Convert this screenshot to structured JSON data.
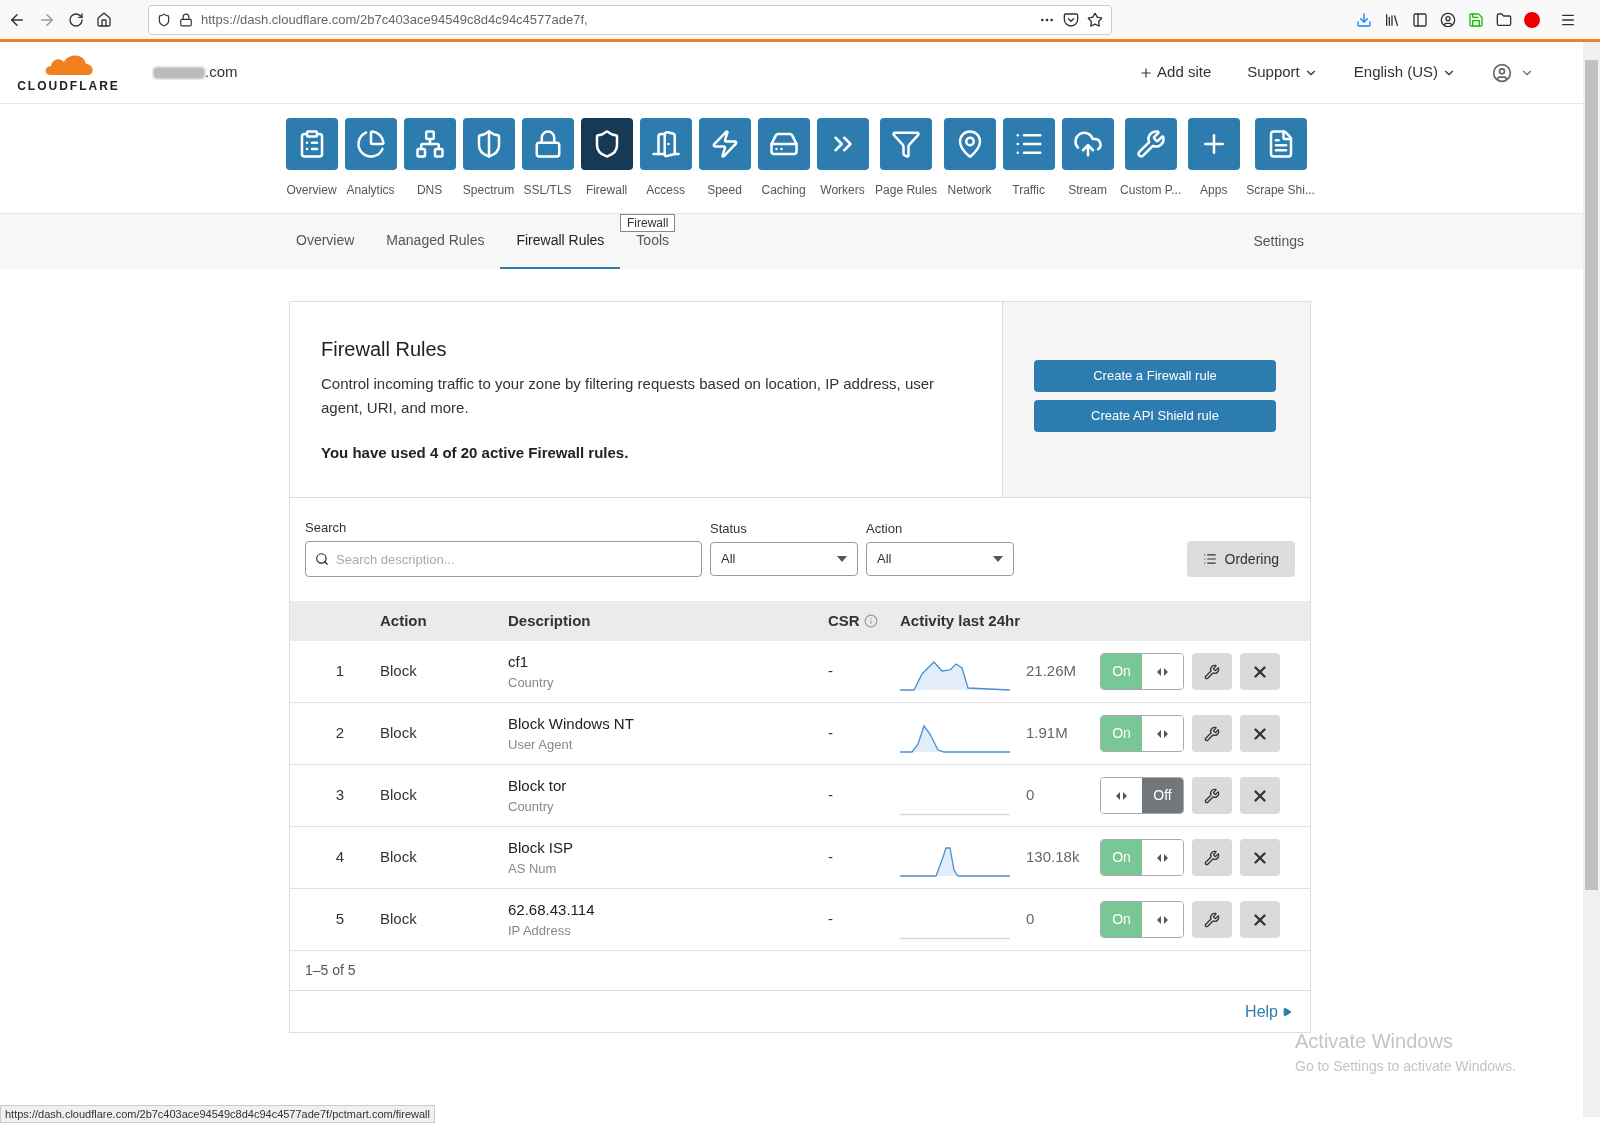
{
  "browser": {
    "url_host": "https://dash.cloudflare.com",
    "url_path": "/2b7c403ace94549c8d4c94c4577ade7f,",
    "status_url": "https://dash.cloudflare.com/2b7c403ace94549c8d4c94c4577ade7f/pctmart.com/firewall"
  },
  "header": {
    "logo": "CLOUDFLARE",
    "domain": ".com",
    "add_site": "Add site",
    "support": "Support",
    "language": "English (US)"
  },
  "apps": [
    {
      "label": "Overview",
      "selected": false
    },
    {
      "label": "Analytics",
      "selected": false
    },
    {
      "label": "DNS",
      "selected": false
    },
    {
      "label": "Spectrum",
      "selected": false
    },
    {
      "label": "SSL/TLS",
      "selected": false
    },
    {
      "label": "Firewall",
      "selected": true
    },
    {
      "label": "Access",
      "selected": false
    },
    {
      "label": "Speed",
      "selected": false
    },
    {
      "label": "Caching",
      "selected": false
    },
    {
      "label": "Workers",
      "selected": false
    },
    {
      "label": "Page Rules",
      "selected": false
    },
    {
      "label": "Network",
      "selected": false
    },
    {
      "label": "Traffic",
      "selected": false
    },
    {
      "label": "Stream",
      "selected": false
    },
    {
      "label": "Custom P...",
      "selected": false
    },
    {
      "label": "Apps",
      "selected": false
    },
    {
      "label": "Scrape Shi...",
      "selected": false
    }
  ],
  "tooltip": "Firewall",
  "subnav": [
    {
      "label": "Overview",
      "selected": false
    },
    {
      "label": "Managed Rules",
      "selected": false
    },
    {
      "label": "Firewall Rules",
      "selected": true
    },
    {
      "label": "Tools",
      "selected": false
    }
  ],
  "subnav_settings": "Settings",
  "intro": {
    "title": "Firewall Rules",
    "text": "Control incoming traffic to your zone by filtering requests based on location, IP address, user agent, URI, and more.",
    "usage": "You have used 4 of 20 active Firewall rules.",
    "buttons": [
      "Create a Firewall rule",
      "Create API Shield rule"
    ]
  },
  "filters": {
    "search_label": "Search",
    "search_placeholder": "Search description...",
    "status_label": "Status",
    "status_value": "All",
    "action_label": "Action",
    "action_value": "All",
    "ordering": "Ordering"
  },
  "table": {
    "columns": [
      "Action",
      "Description",
      "CSR",
      "Activity last 24hr"
    ],
    "rows": [
      {
        "index": "1",
        "action": "Block",
        "description": "cf1",
        "field": "Country",
        "csr": "-",
        "count": "21.26M",
        "on": true,
        "on_label": "On"
      },
      {
        "index": "2",
        "action": "Block",
        "description": "Block Windows NT",
        "field": "User Agent",
        "csr": "-",
        "count": "1.91M",
        "on": true,
        "on_label": "On"
      },
      {
        "index": "3",
        "action": "Block",
        "description": "Block tor",
        "field": "Country",
        "csr": "-",
        "count": "0",
        "on": false,
        "on_label": "Off"
      },
      {
        "index": "4",
        "action": "Block",
        "description": "Block ISP",
        "field": "AS Num",
        "csr": "-",
        "count": "130.18k",
        "on": true,
        "on_label": "On"
      },
      {
        "index": "5",
        "action": "Block",
        "description": "62.68.43.114",
        "field": "IP Address",
        "csr": "-",
        "count": "0",
        "on": true,
        "on_label": "On"
      }
    ]
  },
  "pagination": "1–5 of 5",
  "help": "Help",
  "os_notice": {
    "title": "Activate Windows",
    "text": "Go to Settings to activate Windows."
  }
}
